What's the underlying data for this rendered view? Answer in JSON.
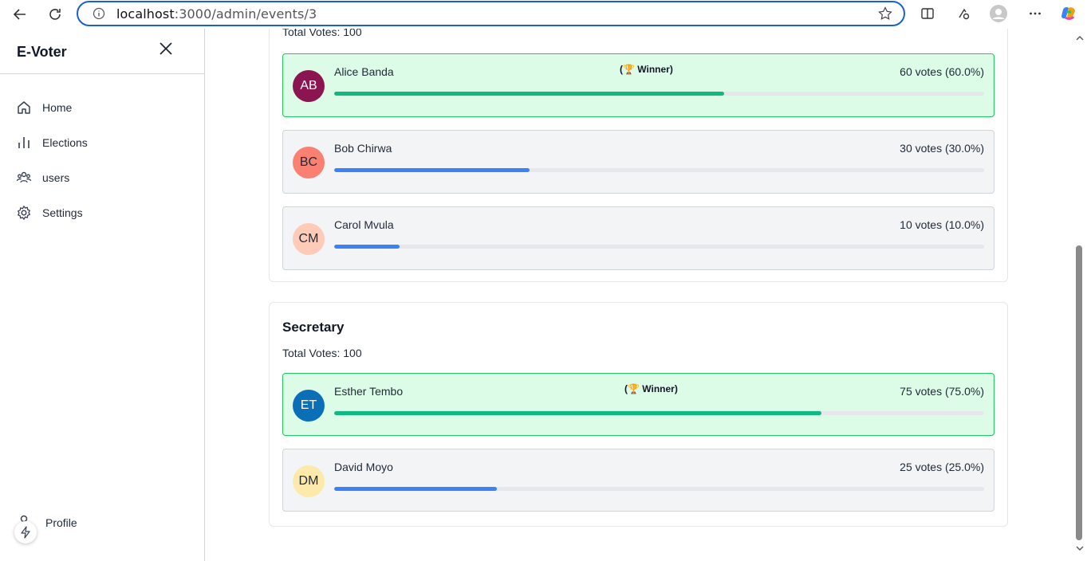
{
  "browser": {
    "url_host": "localhost",
    "url_path": ":3000/admin/events/3"
  },
  "sidebar": {
    "brand": "E-Voter",
    "items": [
      {
        "label": "Home",
        "icon": "home-icon"
      },
      {
        "label": "Elections",
        "icon": "bar-chart-icon"
      },
      {
        "label": "users",
        "icon": "users-icon"
      },
      {
        "label": "Settings",
        "icon": "gear-icon"
      }
    ],
    "profile_label": "Profile"
  },
  "positions": [
    {
      "title": "",
      "total_votes": "Total Votes: 100",
      "candidates": [
        {
          "initials": "AB",
          "name": "Alice Banda",
          "winner": "(🏆 Winner)",
          "votes": "60 votes (60.0%)",
          "percent": 60,
          "avatar_color": "#8b1550",
          "initials_color": "#ffffff"
        },
        {
          "initials": "BC",
          "name": "Bob Chirwa",
          "winner": "",
          "votes": "30 votes (30.0%)",
          "percent": 30,
          "avatar_color": "#fa8072",
          "initials_color": "#1f2937"
        },
        {
          "initials": "CM",
          "name": "Carol Mvula",
          "winner": "",
          "votes": "10 votes (10.0%)",
          "percent": 10,
          "avatar_color": "#fecbb8",
          "initials_color": "#1f2937"
        }
      ]
    },
    {
      "title": "Secretary",
      "total_votes": "Total Votes: 100",
      "candidates": [
        {
          "initials": "ET",
          "name": "Esther Tembo",
          "winner": "(🏆 Winner)",
          "votes": "75 votes (75.0%)",
          "percent": 75,
          "avatar_color": "#0b6fb8",
          "initials_color": "#ffffff"
        },
        {
          "initials": "DM",
          "name": "David Moyo",
          "winner": "",
          "votes": "25 votes (25.0%)",
          "percent": 25,
          "avatar_color": "#fde9a9",
          "initials_color": "#1f2937"
        }
      ]
    }
  ]
}
